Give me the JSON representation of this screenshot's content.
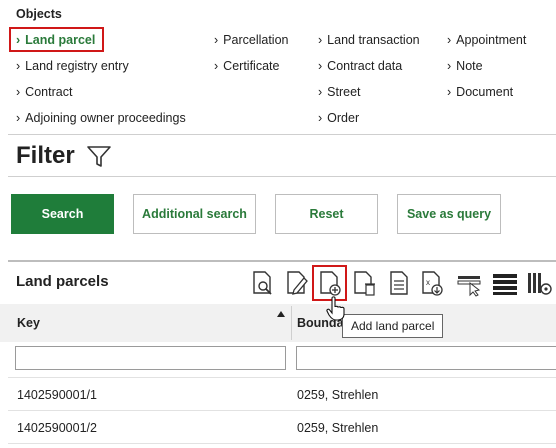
{
  "objects": {
    "heading": "Objects",
    "col1": [
      "Land parcel",
      "Land registry entry",
      "Contract",
      "Adjoining owner proceedings"
    ],
    "col2": [
      "Parcellation",
      "Certificate"
    ],
    "col3": [
      "Land transaction",
      "Contract data",
      "Street",
      "Order"
    ],
    "col4": [
      "Appointment",
      "Note",
      "Document"
    ],
    "chevron": "›"
  },
  "filter": {
    "title": "Filter",
    "icon": "funnel-icon",
    "buttons": {
      "search": "Search",
      "additional": "Additional search",
      "reset": "Reset",
      "save_query": "Save as query"
    }
  },
  "list": {
    "title": "Land parcels",
    "toolbar_icons": [
      "view-icon",
      "edit-icon",
      "add-document-icon",
      "delete-document-icon",
      "document-icon",
      "export-icon",
      "select-icon",
      "rows-icon",
      "columns-settings-icon"
    ],
    "tooltip": "Add land parcel",
    "columns": {
      "key": "Key",
      "boundary": "Boundar"
    },
    "rows": [
      {
        "key": "1402590001/1",
        "boundary": "0259, Strehlen"
      },
      {
        "key": "1402590001/2",
        "boundary": "0259, Strehlen"
      }
    ]
  },
  "colors": {
    "accent": "#1f7d3a",
    "highlight": "#d01818"
  }
}
